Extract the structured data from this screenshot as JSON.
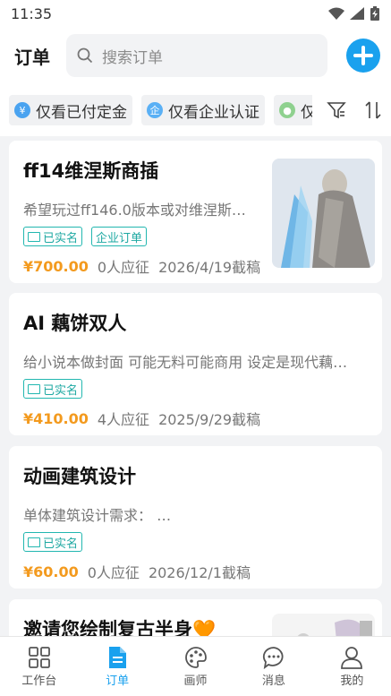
{
  "status": {
    "time": "11:35"
  },
  "header": {
    "title": "订单",
    "search_placeholder": "搜索订单"
  },
  "filters": [
    {
      "label": "仅看已付定金",
      "icon": "yen-icon",
      "color": "#4aa3f0"
    },
    {
      "label": "仅看企业认证",
      "icon": "enterprise-icon",
      "color": "#5ab0f5"
    },
    {
      "label": "仅",
      "icon": "person-icon",
      "color": "#8fd18f"
    }
  ],
  "orders": [
    {
      "title": "ff14维涅斯商插",
      "desc": "希望玩过ff146.0版本或对维涅斯…",
      "tags": [
        "已实名",
        "企业订单"
      ],
      "price": "¥700.00",
      "applicants": "0人应征",
      "deadline": "2026/4/19截稿"
    },
    {
      "title": "AI 藕饼双人",
      "desc": "给小说本做封面 可能无料可能商用 设定是现代藕…",
      "tags": [
        "已实名"
      ],
      "price": "¥410.00",
      "applicants": "4人应征",
      "deadline": "2025/9/29截稿"
    },
    {
      "title": "动画建筑设计",
      "desc": "单体建筑设计需求：  …",
      "tags": [
        "已实名"
      ],
      "price": "¥60.00",
      "applicants": "0人应征",
      "deadline": "2026/12/1截稿"
    },
    {
      "title": "邀请您绘制复古半身🧡",
      "desc": "",
      "tags": [],
      "price": "",
      "applicants": "",
      "deadline": ""
    }
  ],
  "tabbar": [
    {
      "label": "工作台",
      "icon": "grid-icon",
      "active": false
    },
    {
      "label": "订单",
      "icon": "document-icon",
      "active": true
    },
    {
      "label": "画师",
      "icon": "palette-icon",
      "active": false
    },
    {
      "label": "消息",
      "icon": "chat-icon",
      "active": false
    },
    {
      "label": "我的",
      "icon": "user-icon",
      "active": false
    }
  ],
  "colors": {
    "accent": "#1aa1ee",
    "price": "#f39a1e",
    "tag": "#22b7b0"
  }
}
